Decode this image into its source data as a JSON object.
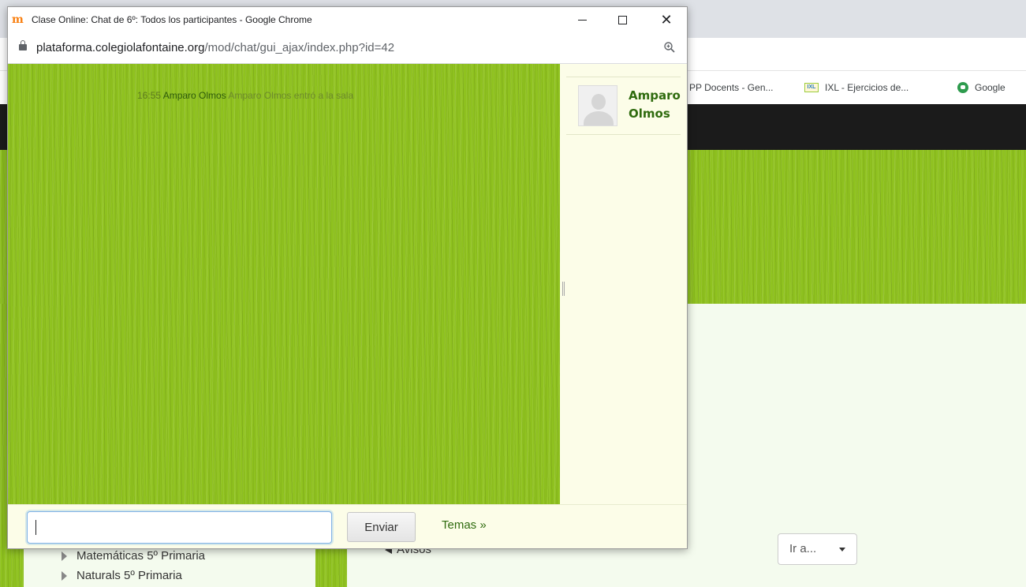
{
  "background": {
    "bookmarks": [
      {
        "label": "PP Docents - Gen...",
        "icon": "folder-icon"
      },
      {
        "label": "IXL - Ejercicios de...",
        "icon": "ixl-icon",
        "icon_text": "IXL"
      },
      {
        "label": "Google",
        "icon": "google-chat-icon"
      }
    ],
    "course_list": [
      {
        "label": "Matemáticas 5º Primaria"
      },
      {
        "label": "Naturals 5º Primaria"
      }
    ],
    "prev_link": "Avisos",
    "jump_select": {
      "value": "Ir a..."
    }
  },
  "popup": {
    "window_title": "Clase Online: Chat de 6º: Todos los participantes - Google Chrome",
    "favicon_text": "m",
    "url": {
      "host": "plataforma.colegiolafontaine.org",
      "path": "/mod/chat/gui_ajax/index.php?id=42"
    },
    "chat": {
      "messages": [
        {
          "time": "16:55",
          "user": "Amparo Olmos",
          "text": "Amparo Olmos entró a la sala"
        }
      ],
      "users": [
        {
          "name": "Amparo Olmos"
        }
      ],
      "input_value": "",
      "send_label": "Enviar",
      "themes_label": "Temas »"
    }
  },
  "colors": {
    "grass": "#8fc21f",
    "panel": "#fcfde8",
    "user_green": "#2f6b0e",
    "navbar": "#1b1b1b"
  }
}
